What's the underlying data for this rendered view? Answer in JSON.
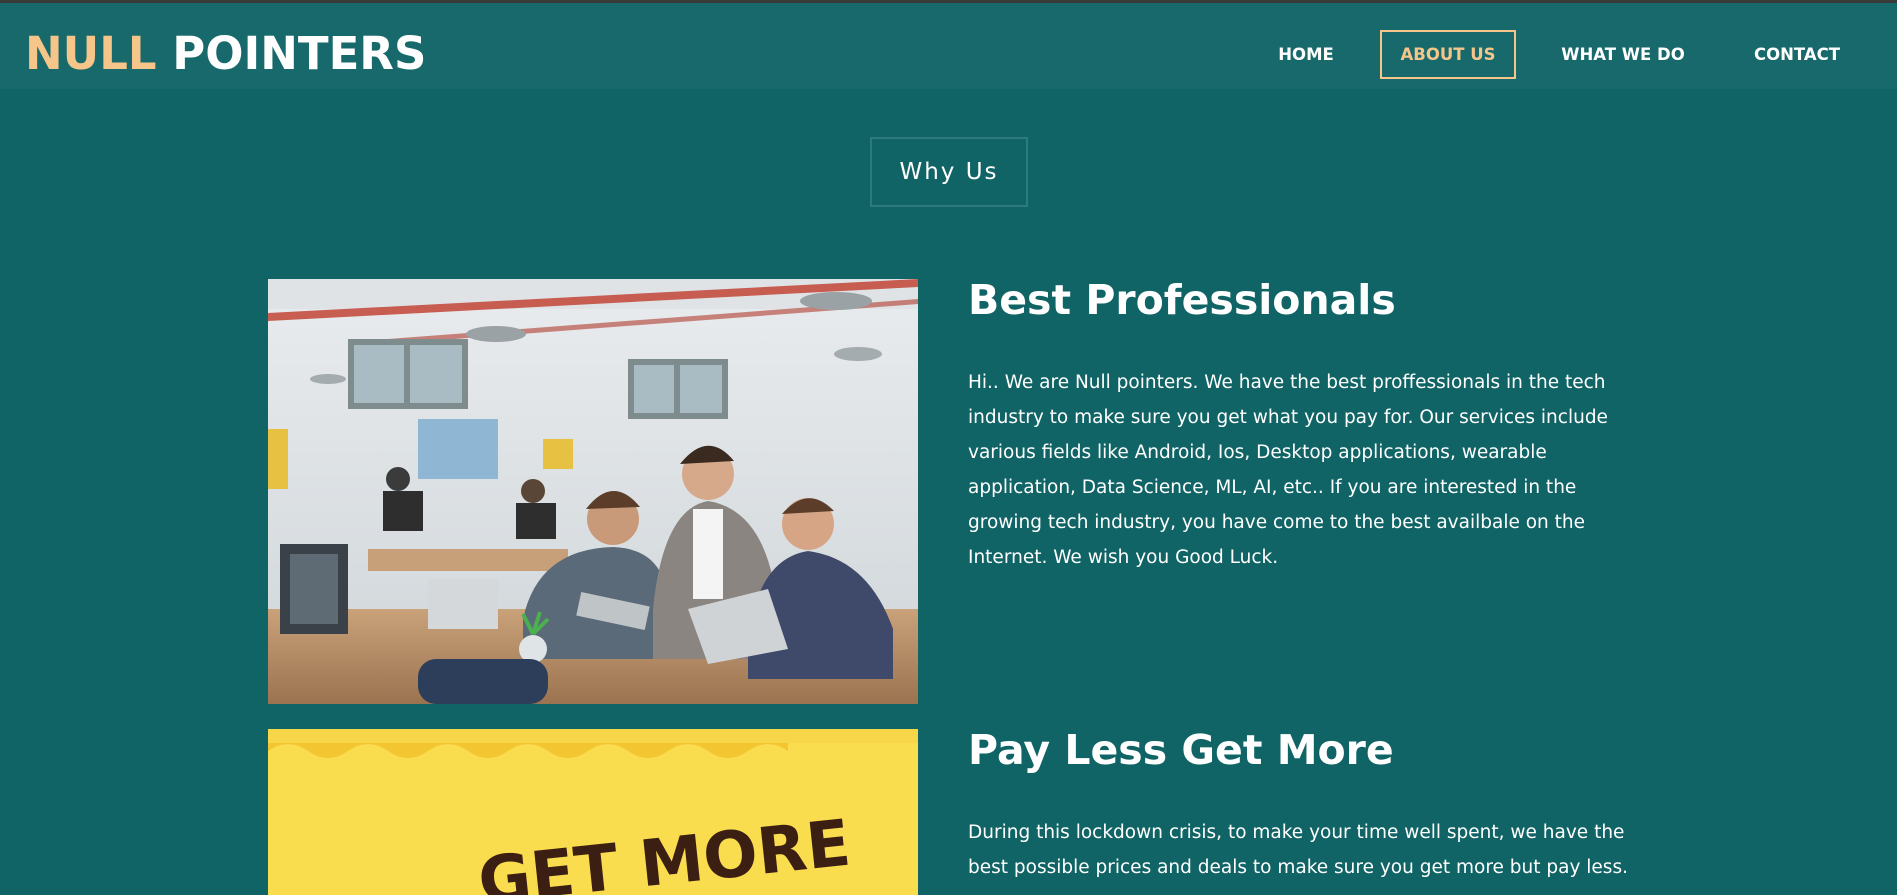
{
  "brand": {
    "part1": "NULL",
    "part2": "POINTERS",
    "accent_color": "#f5c58a",
    "background_color": "#116466"
  },
  "nav": {
    "home": "HOME",
    "about": "ABOUT US",
    "what": "WHAT WE DO",
    "contact": "CONTACT",
    "active": "about"
  },
  "section_title": "Why Us",
  "features": [
    {
      "heading": "Best Professionals",
      "text": "Hi.. We are Null pointers. We have the best proffessionals in the tech industry to make sure you get what you pay for. Our services include various fields like Android, Ios, Desktop applications, wearable application, Data Science, ML, AI, etc.. If you are interested in the growing tech industry, you have come to the best availbale on the Internet. We wish you Good Luck.",
      "image_icon": "office-team-photo"
    },
    {
      "heading": "Pay Less Get More",
      "text": "During this lockdown crisis, to make your time well spent, we have the best possible prices and deals to make sure you get more but pay less.",
      "image_icon": "get-more-pay-less-banner",
      "banner_text": "GET MORE"
    }
  ]
}
